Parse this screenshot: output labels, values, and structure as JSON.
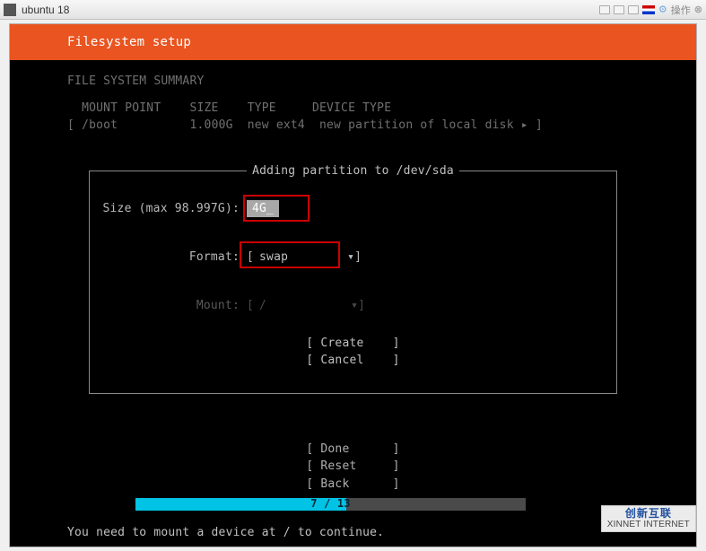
{
  "window": {
    "title": "ubuntu 18",
    "action_label": "操作"
  },
  "header": {
    "title": "Filesystem setup"
  },
  "summary": {
    "title": "FILE SYSTEM SUMMARY",
    "cols": {
      "mount": "MOUNT POINT",
      "size": "SIZE",
      "type": "TYPE",
      "device": "DEVICE TYPE"
    },
    "rows": [
      {
        "mount": "/boot",
        "size": "1.000G",
        "type": "new ext4",
        "device": "new partition of local disk"
      }
    ]
  },
  "dialog": {
    "title": "Adding partition to /dev/sda",
    "size_label": "Size (max 98.997G):",
    "size_value": "4G_",
    "format_label": "Format:",
    "format_value": "swap",
    "mount_label": "Mount:",
    "mount_value": "/",
    "create": "Create",
    "cancel": "Cancel"
  },
  "bottom": {
    "done": "Done",
    "reset": "Reset",
    "back": "Back"
  },
  "progress": {
    "current": 7,
    "total": 13,
    "label": "7 / 13"
  },
  "foot": "You need to mount a device at / to continue.",
  "watermark": {
    "brand": "创新互联",
    "sub": "XINNET INTERNET"
  }
}
